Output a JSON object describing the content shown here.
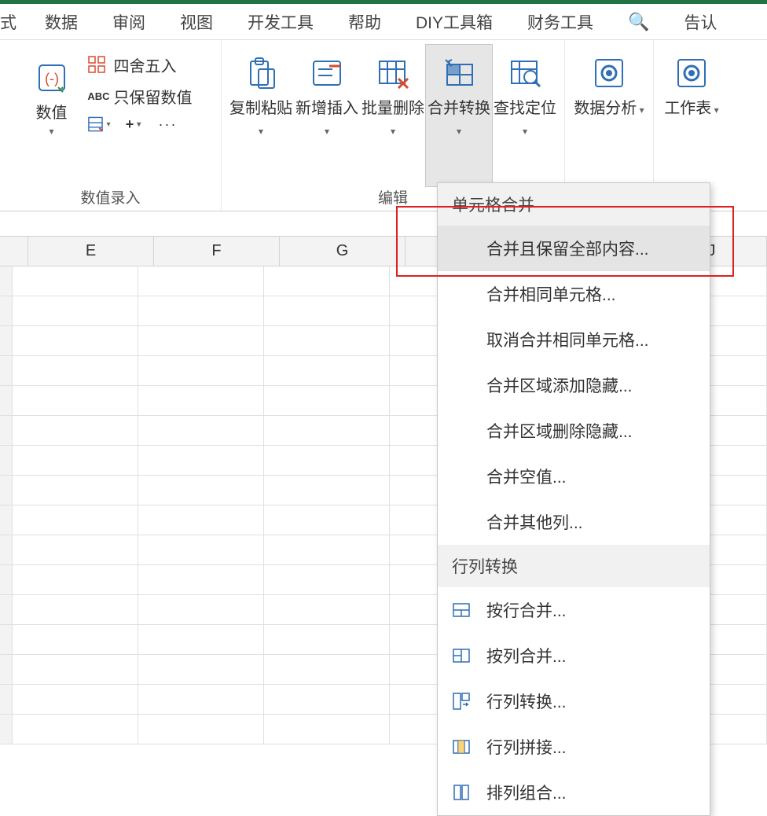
{
  "tabs": {
    "t0": "式",
    "t1": "数据",
    "t2": "审阅",
    "t3": "视图",
    "t4": "开发工具",
    "t5": "帮助",
    "t6": "DIY工具箱",
    "t7": "财务工具",
    "t8_partial": "告认"
  },
  "ribbon": {
    "group1": {
      "numeric_btn": "数值",
      "round": "四舍五入",
      "keep_numeric": "只保留数值",
      "label": "数值录入"
    },
    "group2": {
      "copy_paste": "复制粘贴",
      "new_insert": "新增插入",
      "batch_delete": "批量删除",
      "merge_convert": "合并转换",
      "find_locate": "查找定位",
      "label": "编辑"
    },
    "group3": {
      "data_analysis": "数据分析"
    },
    "group4": {
      "worksheet": "工作表"
    }
  },
  "columns": {
    "c0": "E",
    "c1": "F",
    "c2": "G",
    "c3": "J"
  },
  "menu": {
    "section1": "单元格合并",
    "i0": "合并且保留全部内容...",
    "i1": "合并相同单元格...",
    "i2": "取消合并相同单元格...",
    "i3": "合并区域添加隐藏...",
    "i4": "合并区域删除隐藏...",
    "i5": "合并空值...",
    "i6": "合并其他列...",
    "section2": "行列转换",
    "i7": "按行合并...",
    "i8": "按列合并...",
    "i9": "行列转换...",
    "i10": "行列拼接...",
    "i11": "排列组合..."
  }
}
